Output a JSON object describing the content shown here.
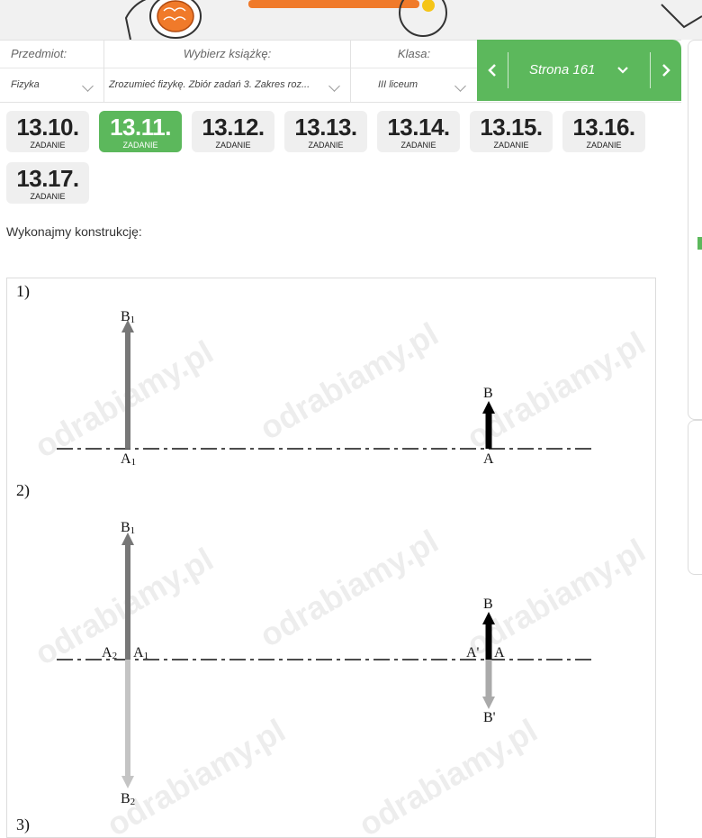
{
  "selectors": {
    "subject": {
      "label": "Przedmiot:",
      "value": "Fizyka"
    },
    "book": {
      "label": "Wybierz książkę:",
      "value": "Zrozumieć fizykę. Zbiór zadań 3. Zakres roz..."
    },
    "grade": {
      "label": "Klasa:",
      "value": "III liceum"
    }
  },
  "page": {
    "label": "Strona 161"
  },
  "tasks": [
    {
      "number": "13.10.",
      "label": "ZADANIE",
      "active": false
    },
    {
      "number": "13.11.",
      "label": "ZADANIE",
      "active": true
    },
    {
      "number": "13.12.",
      "label": "ZADANIE",
      "active": false
    },
    {
      "number": "13.13.",
      "label": "ZADANIE",
      "active": false
    },
    {
      "number": "13.14.",
      "label": "ZADANIE",
      "active": false
    },
    {
      "number": "13.15.",
      "label": "ZADANIE",
      "active": false
    },
    {
      "number": "13.16.",
      "label": "ZADANIE",
      "active": false
    },
    {
      "number": "13.17.",
      "label": "ZADANIE",
      "active": false
    }
  ],
  "intro_text": "Wykonajmy konstrukcję:",
  "figure": {
    "parts": [
      "1)",
      "2)",
      "3)"
    ],
    "part1_labels": {
      "b1": "B",
      "b1_sub": "1",
      "a1": "A",
      "a1_sub": "1",
      "b": "B",
      "a": "A"
    },
    "part2_labels": {
      "b1": "B",
      "b1_sub": "1",
      "a2": "A",
      "a2_sub": "2",
      "a1": "A",
      "a1_sub": "1",
      "b": "B",
      "a_prime": "A'",
      "a": "A",
      "b_prime": "B'",
      "b2": "B",
      "b2_sub": "2"
    },
    "watermark": "odrabiamy.pl"
  },
  "colors": {
    "accent": "#5cb85c",
    "orange": "#f07a2a"
  }
}
